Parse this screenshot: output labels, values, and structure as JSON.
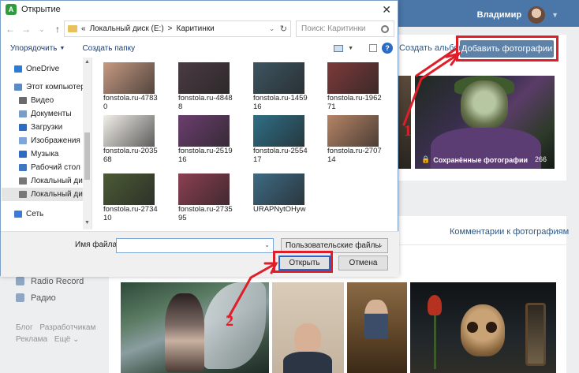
{
  "vk": {
    "header": {
      "username": "Владимир"
    },
    "album_link": "Создать альбом",
    "add_photos": "Добавить фотографии",
    "album": {
      "caption": "Сохранённые фотографии",
      "count": "266"
    },
    "comments_link": "Комментарии к фотографиям",
    "left_menu": [
      {
        "label": "Radio Record",
        "icon": "app-icon"
      },
      {
        "label": "Радио",
        "icon": "app-icon"
      }
    ],
    "footer": {
      "line1": [
        "Блог",
        "Разработчикам"
      ],
      "line2": [
        "Реклама",
        "Ещё ⌄"
      ]
    }
  },
  "dialog": {
    "title": "Открытие",
    "app_icon_letter": "A",
    "path": {
      "prefix": "«",
      "parts": [
        "Локальный диск (E:)",
        "Каритинки"
      ],
      "separator": ">"
    },
    "search_placeholder": "Поиск: Каритинки",
    "toolbar": {
      "organize": "Упорядочить",
      "new_folder": "Создать папку"
    },
    "nav_items": [
      {
        "label": "OneDrive",
        "icon": "cloud-icon",
        "color": "#2b7cd3"
      },
      {
        "label": "Этот компьютер",
        "icon": "computer-icon",
        "color": "#5b8ac4"
      },
      {
        "label": "Видео",
        "icon": "video-icon",
        "color": "#6a6a6a"
      },
      {
        "label": "Документы",
        "icon": "documents-icon",
        "color": "#7a9cc8"
      },
      {
        "label": "Загрузки",
        "icon": "downloads-icon",
        "color": "#2b6cc4"
      },
      {
        "label": "Изображения",
        "icon": "pictures-icon",
        "color": "#7da7d9"
      },
      {
        "label": "Музыка",
        "icon": "music-icon",
        "color": "#2b6cc4"
      },
      {
        "label": "Рабочий стол",
        "icon": "desktop-icon",
        "color": "#3f77c2"
      },
      {
        "label": "Локальный диск",
        "icon": "drive-icon",
        "color": "#777777"
      },
      {
        "label": "Локальный дис",
        "icon": "drive-icon",
        "color": "#777777",
        "selected": true
      },
      {
        "label": "Сеть",
        "icon": "network-icon",
        "color": "#3a7bd5"
      }
    ],
    "files": [
      {
        "name": "fonstola.ru-47830",
        "thumb": "#c79a82"
      },
      {
        "name": "fonstola.ru-48488",
        "thumb": "#4a3b42"
      },
      {
        "name": "fonstola.ru-145916",
        "thumb": "#3d5561"
      },
      {
        "name": "fonstola.ru-196271",
        "thumb": "#7d3a3a"
      },
      {
        "name": "fonstola.ru-203568",
        "thumb": "#f2efe9"
      },
      {
        "name": "fonstola.ru-251916",
        "thumb": "#6b3e6e"
      },
      {
        "name": "fonstola.ru-255417",
        "thumb": "#2f6f86"
      },
      {
        "name": "fonstola.ru-270714",
        "thumb": "#b58466"
      },
      {
        "name": "fonstola.ru-273410",
        "thumb": "#4b5a36"
      },
      {
        "name": "fonstola.ru-273595",
        "thumb": "#8c3f52"
      },
      {
        "name": "URAPNytOHyw",
        "thumb": "#3e6b83"
      }
    ],
    "filename_label": "Имя файла:",
    "filename_value": "",
    "filter": "Пользовательские файлы",
    "open_button": "Открыть",
    "cancel_button": "Отмена"
  },
  "annotations": {
    "marker1": "1",
    "marker2": "2",
    "color": "#e01e2a"
  }
}
